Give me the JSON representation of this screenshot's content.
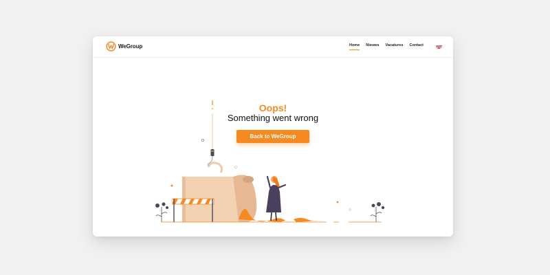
{
  "brand": {
    "name": "WeGroup"
  },
  "nav": {
    "items": [
      {
        "label": "Home",
        "active": true
      },
      {
        "label": "Nieuws",
        "active": false
      },
      {
        "label": "Vacatures",
        "active": false
      },
      {
        "label": "Contact",
        "active": false
      }
    ],
    "language_icon": "uk-flag-icon"
  },
  "error": {
    "title": "Oops!",
    "message": "Something went wrong",
    "button_label": "Back to WeGroup"
  },
  "colors": {
    "accent": "#f6891f",
    "background": "#f1f1f1",
    "card": "#ffffff",
    "text": "#111111"
  },
  "illustration": "construction-error-illustration"
}
